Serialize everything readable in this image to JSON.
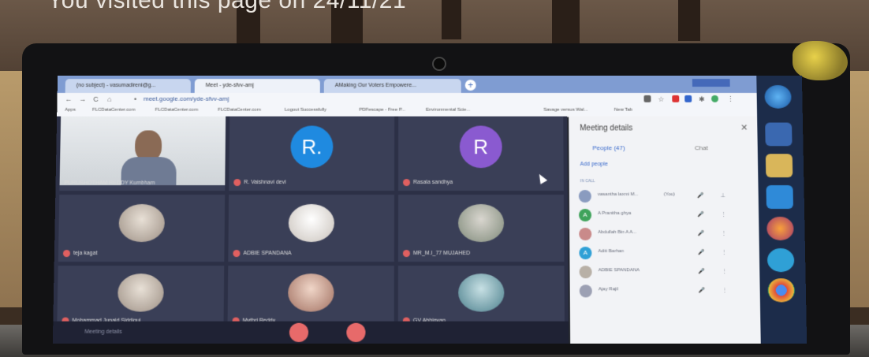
{
  "overlay": {
    "text": "You visited this page on 24/11/21"
  },
  "browser": {
    "tabs": [
      {
        "label": "(no subject) - vasumadireni@g..."
      },
      {
        "label": "Meet - yde-sfvv-amj"
      },
      {
        "label": "AMaking Our Voters Empowere..."
      }
    ],
    "url": "meet.google.com/yde-sfvv-amj",
    "bookmarks": [
      "Apps",
      "FLCDataCenter.com",
      "FLCDataCenter.com",
      "FLCDataCenter.com",
      "Logout Successfully",
      "PDFescape - Free P...",
      "Environmental Scie...",
      "Savage versus Wal...",
      "New Tab"
    ]
  },
  "meeting": {
    "label": "Meeting details",
    "tiles": [
      {
        "name": "PURUSHOTHAM REDDY Kumbham"
      },
      {
        "name": "R. Vaishnavi devi",
        "initial": "R."
      },
      {
        "name": "Rasala sandhya",
        "initial": "R"
      },
      {
        "name": "teja kagat"
      },
      {
        "name": "ADBIE SPANDANA"
      },
      {
        "name": "MR_M.I_77 MUJAHED"
      },
      {
        "name": "Mohammad Junaid Siddiqui"
      },
      {
        "name": "Mythri Reddy"
      },
      {
        "name": "GV Abhigyan"
      }
    ],
    "colors": {
      "avatar_blue": "#1f8ae0",
      "avatar_purple": "#8a5ad0",
      "mic_red": "#e06060",
      "end_call": "#e76a6a"
    }
  },
  "panel": {
    "title": "Meeting details",
    "people_tab": "People (47)",
    "chat_tab": "Chat",
    "add_people": "Add people",
    "section": "IN CALL",
    "participants": [
      {
        "name": "vasantha laxmi M...",
        "tag": "(You)",
        "initial": ""
      },
      {
        "name": "A Pranitha ghya",
        "initial": "A"
      },
      {
        "name": "Abdullah Bin A A...",
        "initial": ""
      },
      {
        "name": "Aditi Barhan",
        "initial": "A"
      },
      {
        "name": "ADBIE SPANDANA",
        "initial": ""
      },
      {
        "name": "Ajay Rajil",
        "initial": ""
      }
    ]
  }
}
